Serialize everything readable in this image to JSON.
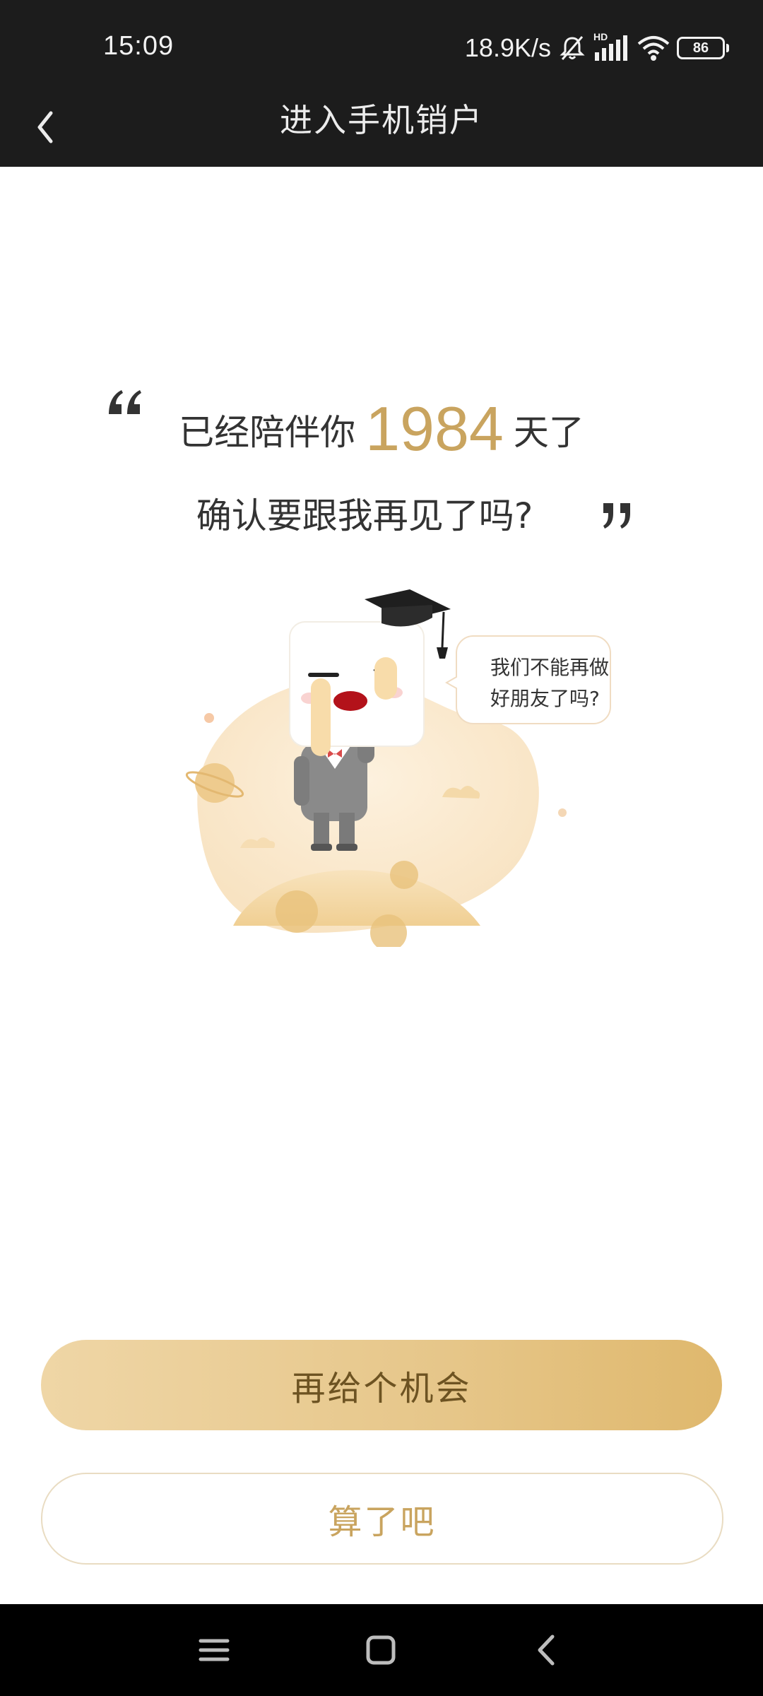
{
  "status_bar": {
    "time": "15:09",
    "network_speed": "18.9K/s",
    "network_type": "HD",
    "battery_level": "86",
    "icons": [
      "mute-icon",
      "signal-icon",
      "wifi-icon",
      "battery-icon"
    ]
  },
  "header": {
    "title": "进入手机销户",
    "back_icon": "chevron-left-icon"
  },
  "message": {
    "prefix": "已经陪伴你",
    "days": "1984",
    "suffix": "天了",
    "line2": "确认要跟我再见了吗?"
  },
  "illustration": {
    "bubble_line1": "我们不能再做",
    "bubble_line2": "好朋友了吗?"
  },
  "buttons": {
    "primary_label": "再给个机会",
    "secondary_label": "算了吧"
  },
  "nav_bar": {
    "icons": [
      "menu-icon",
      "home-icon",
      "back-icon"
    ]
  },
  "colors": {
    "accent_gold": "#c9a45f",
    "button_gradient_start": "#efd6a6",
    "button_gradient_end": "#dfb86d",
    "header_bg": "#1c1c1c"
  }
}
